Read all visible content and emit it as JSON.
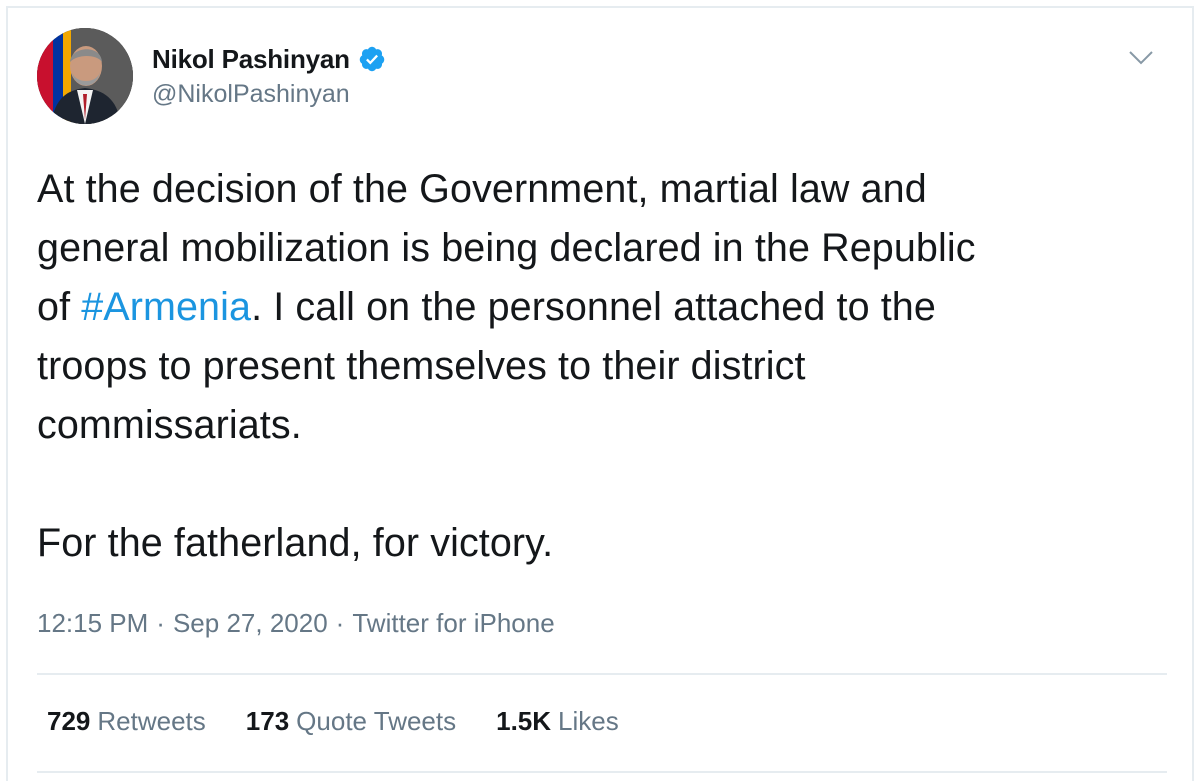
{
  "author": {
    "name": "Nikol Pashinyan",
    "handle": "@NikolPashinyan",
    "verified": true
  },
  "icons": {
    "verified": "verified-badge-icon",
    "caret": "chevron-down-icon"
  },
  "tweet": {
    "lines": [
      "At the decision of the Government, martial law and",
      "general mobilization is being declared in the Republic"
    ],
    "line3_before": "of ",
    "hashtag": "#Armenia",
    "line3_after": ". I call on the personnel attached to the",
    "lines_after": [
      "troops to present themselves to their district",
      "commissariats."
    ],
    "closing": "For the fatherland, for victory."
  },
  "meta": {
    "time": "12:15 PM",
    "separator": "·",
    "date": "Sep 27, 2020",
    "source": "Twitter for iPhone"
  },
  "stats": {
    "retweets": {
      "count": "729",
      "label": "Retweets"
    },
    "quote_tweets": {
      "count": "173",
      "label": "Quote Tweets"
    },
    "likes": {
      "count": "1.5K",
      "label": "Likes"
    }
  },
  "colors": {
    "text": "#14171a",
    "secondary": "#657786",
    "link": "#1b95e0",
    "verified": "#1da1f2",
    "border": "#e6ecf0"
  }
}
